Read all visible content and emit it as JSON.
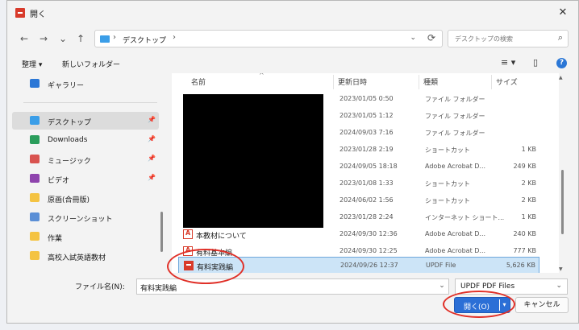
{
  "window": {
    "title": "開く",
    "close_label": "✕"
  },
  "nav": {
    "back": "←",
    "forward": "→",
    "recent": "⌄",
    "up": "↑",
    "breadcrumb": "デスクトップ",
    "separator": "›",
    "dropdown": "⌄",
    "refresh": "⟳",
    "search_placeholder": "デスクトップの検索",
    "search_icon": "⌕"
  },
  "toolbar": {
    "organize": "整理 ▾",
    "new_folder": "新しいフォルダー",
    "view_icon": "≡ ▾",
    "pane_icon": "▯",
    "help_icon": "?"
  },
  "sidebar": {
    "items": [
      {
        "label": "ギャラリー",
        "color": "#2b77d6",
        "pinned": ""
      },
      {
        "label": "デスクトップ",
        "color": "#3b9ee8",
        "pinned": "📌"
      },
      {
        "label": "Downloads",
        "color": "#2a9d5b",
        "pinned": "📌"
      },
      {
        "label": "ミュージック",
        "color": "#d9534f",
        "pinned": "📌"
      },
      {
        "label": "ビデオ",
        "color": "#8e44ad",
        "pinned": "📌"
      },
      {
        "label": "原画(合冊版)",
        "color": "#f4c342",
        "pinned": ""
      },
      {
        "label": "スクリーンショット",
        "color": "#5b8fd6",
        "pinned": ""
      },
      {
        "label": "作業",
        "color": "#f4c342",
        "pinned": ""
      },
      {
        "label": "高校入試英語教材",
        "color": "#f4c342",
        "pinned": ""
      }
    ]
  },
  "columns": {
    "name": "名前",
    "date": "更新日時",
    "type": "種類",
    "size": "サイズ",
    "sort": "^"
  },
  "files": [
    {
      "name": "",
      "date": "2023/01/05 0:50",
      "type": "ファイル フォルダー",
      "size": "",
      "icon": "folder"
    },
    {
      "name": "",
      "date": "2023/01/05 1:12",
      "type": "ファイル フォルダー",
      "size": "",
      "icon": "folder"
    },
    {
      "name": "",
      "date": "2024/09/03 7:16",
      "type": "ファイル フォルダー",
      "size": "",
      "icon": "folder"
    },
    {
      "name": "",
      "date": "2023/01/28 2:19",
      "type": "ショートカット",
      "size": "1 KB",
      "icon": "shortcut"
    },
    {
      "name": "",
      "date": "2024/09/05 18:18",
      "type": "Adobe Acrobat D...",
      "size": "249 KB",
      "icon": "pdf"
    },
    {
      "name": "",
      "date": "2023/01/08 1:33",
      "type": "ショートカット",
      "size": "2 KB",
      "icon": "shortcut"
    },
    {
      "name": "",
      "date": "2024/06/02 1:56",
      "type": "ショートカット",
      "size": "2 KB",
      "icon": "shortcut"
    },
    {
      "name": "",
      "date": "2023/01/28 2:24",
      "type": "インターネット ショート...",
      "size": "1 KB",
      "icon": "shortcut"
    },
    {
      "name": "本教材について",
      "date": "2024/09/30 12:36",
      "type": "Adobe Acrobat D...",
      "size": "240 KB",
      "icon": "pdf"
    },
    {
      "name": "有料基本編",
      "date": "2024/09/30 12:25",
      "type": "Adobe Acrobat D...",
      "size": "777 KB",
      "icon": "pdf"
    },
    {
      "name": "有料実践編",
      "date": "2024/09/26 12:37",
      "type": "UPDF File",
      "size": "5,626 KB",
      "icon": "updf"
    }
  ],
  "bottom": {
    "filename_label": "ファイル名(N):",
    "filename_value": "有料実践編",
    "dropdown": "⌄",
    "filter": "UPDF PDF Files",
    "open_label": "開く(O)",
    "open_split": "▾",
    "cancel_label": "キャンセル"
  },
  "colors": {
    "accent": "#2b6fd6",
    "selection": "#cce4f7",
    "annotation": "#e03028"
  }
}
